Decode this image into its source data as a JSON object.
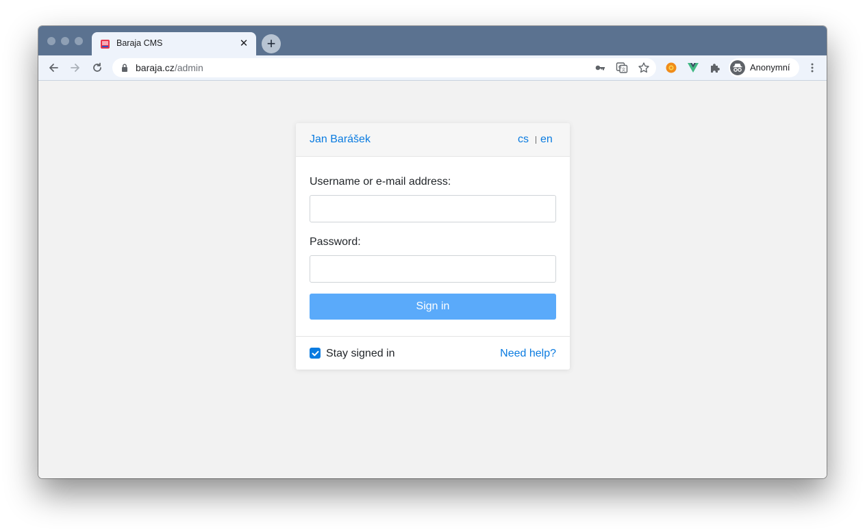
{
  "browser": {
    "tab": {
      "title": "Baraja CMS",
      "favicon": "baraja-favicon-icon",
      "close_glyph": "✕"
    },
    "new_tab_glyph": "+",
    "address": {
      "host": "baraja.cz",
      "path": "/admin"
    },
    "profile": {
      "name": "Anonymní",
      "icon": "incognito-icon"
    },
    "icons": {
      "back": "arrow-back-icon",
      "forward": "arrow-forward-icon",
      "reload": "reload-icon",
      "lock": "lock-icon",
      "key": "key-icon",
      "translate": "translate-icon",
      "bookmark": "star-icon",
      "extension_1": "sun-extension-icon",
      "extension_2": "vue-devtools-icon",
      "extensions": "puzzle-icon",
      "menu": "kebab-menu-icon"
    }
  },
  "login": {
    "brand": "Jan Barášek",
    "languages": [
      "cs",
      "en"
    ],
    "username_label": "Username or e-mail address:",
    "username_value": "",
    "password_label": "Password:",
    "password_value": "",
    "submit_label": "Sign in",
    "remember_label": "Stay signed in",
    "remember_checked": true,
    "help_label": "Need help?"
  },
  "colors": {
    "link": "#0a7be0",
    "button": "#5aaafa",
    "tabstrip": "#5b7290",
    "page_bg": "#f2f2f2"
  }
}
